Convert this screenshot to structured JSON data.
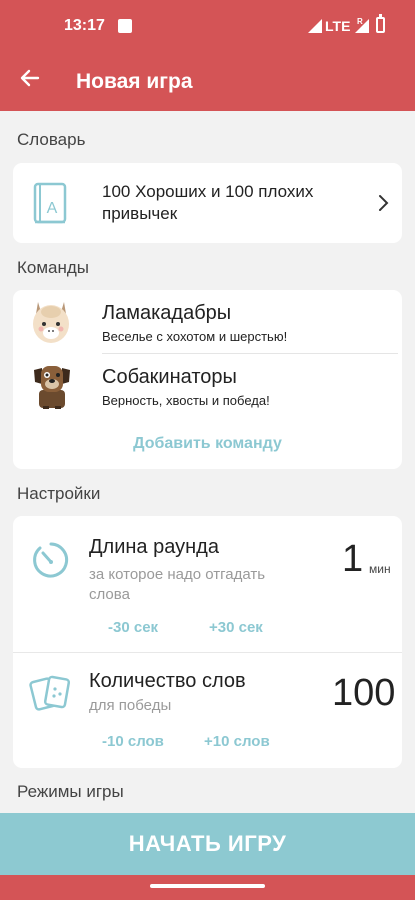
{
  "status": {
    "time": "13:17",
    "network": "LTE",
    "roaming": "R"
  },
  "header": {
    "title": "Новая игра"
  },
  "dictionary": {
    "section_label": "Словарь",
    "name": "100 Хороших и 100 плохих привычек"
  },
  "teams": {
    "section_label": "Команды",
    "items": [
      {
        "name": "Ламакадабры",
        "motto": "Веселье с хохотом и шерстью!",
        "avatar": "llama-avatar"
      },
      {
        "name": "Собакинаторы",
        "motto": "Верность, хвосты и победа!",
        "avatar": "dog-avatar"
      }
    ],
    "add_label": "Добавить команду"
  },
  "settings": {
    "section_label": "Настройки",
    "round_length": {
      "title": "Длина раунда",
      "subtitle": "за которое надо отгадать слова",
      "value": "1",
      "unit": "мин",
      "decrease_label": "-30 сек",
      "increase_label": "+30 сек"
    },
    "word_count": {
      "title": "Количество слов",
      "subtitle": "для победы",
      "value": "100",
      "decrease_label": "-10 слов",
      "increase_label": "+10 слов"
    }
  },
  "modes": {
    "section_label": "Режимы игры"
  },
  "start_button": {
    "label": "НАЧАТЬ ИГРУ"
  },
  "colors": {
    "brand_red": "#d45456",
    "accent_teal": "#8cc8d2",
    "background": "#f2f2f2"
  }
}
